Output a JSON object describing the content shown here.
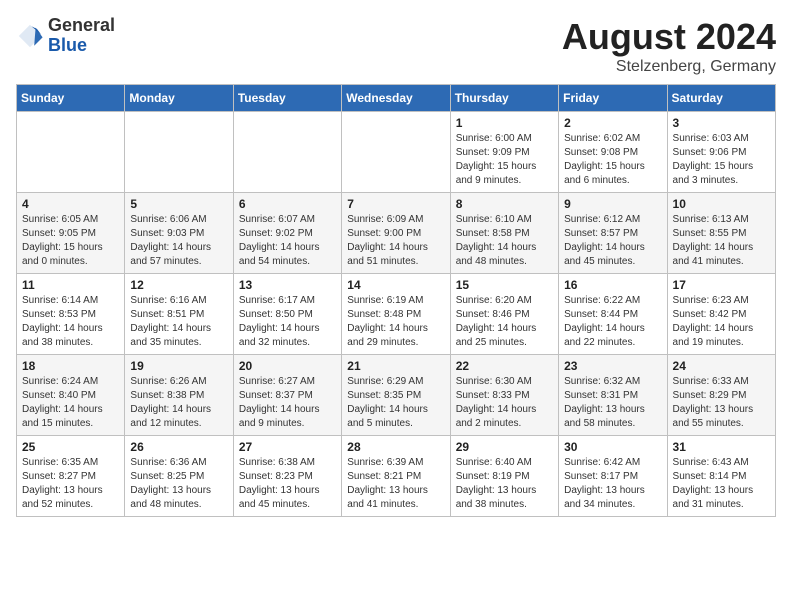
{
  "header": {
    "logo_general": "General",
    "logo_blue": "Blue",
    "month_year": "August 2024",
    "location": "Stelzenberg, Germany"
  },
  "days_of_week": [
    "Sunday",
    "Monday",
    "Tuesday",
    "Wednesday",
    "Thursday",
    "Friday",
    "Saturday"
  ],
  "weeks": [
    [
      {
        "day": "",
        "info": ""
      },
      {
        "day": "",
        "info": ""
      },
      {
        "day": "",
        "info": ""
      },
      {
        "day": "",
        "info": ""
      },
      {
        "day": "1",
        "info": "Sunrise: 6:00 AM\nSunset: 9:09 PM\nDaylight: 15 hours\nand 9 minutes."
      },
      {
        "day": "2",
        "info": "Sunrise: 6:02 AM\nSunset: 9:08 PM\nDaylight: 15 hours\nand 6 minutes."
      },
      {
        "day": "3",
        "info": "Sunrise: 6:03 AM\nSunset: 9:06 PM\nDaylight: 15 hours\nand 3 minutes."
      }
    ],
    [
      {
        "day": "4",
        "info": "Sunrise: 6:05 AM\nSunset: 9:05 PM\nDaylight: 15 hours\nand 0 minutes."
      },
      {
        "day": "5",
        "info": "Sunrise: 6:06 AM\nSunset: 9:03 PM\nDaylight: 14 hours\nand 57 minutes."
      },
      {
        "day": "6",
        "info": "Sunrise: 6:07 AM\nSunset: 9:02 PM\nDaylight: 14 hours\nand 54 minutes."
      },
      {
        "day": "7",
        "info": "Sunrise: 6:09 AM\nSunset: 9:00 PM\nDaylight: 14 hours\nand 51 minutes."
      },
      {
        "day": "8",
        "info": "Sunrise: 6:10 AM\nSunset: 8:58 PM\nDaylight: 14 hours\nand 48 minutes."
      },
      {
        "day": "9",
        "info": "Sunrise: 6:12 AM\nSunset: 8:57 PM\nDaylight: 14 hours\nand 45 minutes."
      },
      {
        "day": "10",
        "info": "Sunrise: 6:13 AM\nSunset: 8:55 PM\nDaylight: 14 hours\nand 41 minutes."
      }
    ],
    [
      {
        "day": "11",
        "info": "Sunrise: 6:14 AM\nSunset: 8:53 PM\nDaylight: 14 hours\nand 38 minutes."
      },
      {
        "day": "12",
        "info": "Sunrise: 6:16 AM\nSunset: 8:51 PM\nDaylight: 14 hours\nand 35 minutes."
      },
      {
        "day": "13",
        "info": "Sunrise: 6:17 AM\nSunset: 8:50 PM\nDaylight: 14 hours\nand 32 minutes."
      },
      {
        "day": "14",
        "info": "Sunrise: 6:19 AM\nSunset: 8:48 PM\nDaylight: 14 hours\nand 29 minutes."
      },
      {
        "day": "15",
        "info": "Sunrise: 6:20 AM\nSunset: 8:46 PM\nDaylight: 14 hours\nand 25 minutes."
      },
      {
        "day": "16",
        "info": "Sunrise: 6:22 AM\nSunset: 8:44 PM\nDaylight: 14 hours\nand 22 minutes."
      },
      {
        "day": "17",
        "info": "Sunrise: 6:23 AM\nSunset: 8:42 PM\nDaylight: 14 hours\nand 19 minutes."
      }
    ],
    [
      {
        "day": "18",
        "info": "Sunrise: 6:24 AM\nSunset: 8:40 PM\nDaylight: 14 hours\nand 15 minutes."
      },
      {
        "day": "19",
        "info": "Sunrise: 6:26 AM\nSunset: 8:38 PM\nDaylight: 14 hours\nand 12 minutes."
      },
      {
        "day": "20",
        "info": "Sunrise: 6:27 AM\nSunset: 8:37 PM\nDaylight: 14 hours\nand 9 minutes."
      },
      {
        "day": "21",
        "info": "Sunrise: 6:29 AM\nSunset: 8:35 PM\nDaylight: 14 hours\nand 5 minutes."
      },
      {
        "day": "22",
        "info": "Sunrise: 6:30 AM\nSunset: 8:33 PM\nDaylight: 14 hours\nand 2 minutes."
      },
      {
        "day": "23",
        "info": "Sunrise: 6:32 AM\nSunset: 8:31 PM\nDaylight: 13 hours\nand 58 minutes."
      },
      {
        "day": "24",
        "info": "Sunrise: 6:33 AM\nSunset: 8:29 PM\nDaylight: 13 hours\nand 55 minutes."
      }
    ],
    [
      {
        "day": "25",
        "info": "Sunrise: 6:35 AM\nSunset: 8:27 PM\nDaylight: 13 hours\nand 52 minutes."
      },
      {
        "day": "26",
        "info": "Sunrise: 6:36 AM\nSunset: 8:25 PM\nDaylight: 13 hours\nand 48 minutes."
      },
      {
        "day": "27",
        "info": "Sunrise: 6:38 AM\nSunset: 8:23 PM\nDaylight: 13 hours\nand 45 minutes."
      },
      {
        "day": "28",
        "info": "Sunrise: 6:39 AM\nSunset: 8:21 PM\nDaylight: 13 hours\nand 41 minutes."
      },
      {
        "day": "29",
        "info": "Sunrise: 6:40 AM\nSunset: 8:19 PM\nDaylight: 13 hours\nand 38 minutes."
      },
      {
        "day": "30",
        "info": "Sunrise: 6:42 AM\nSunset: 8:17 PM\nDaylight: 13 hours\nand 34 minutes."
      },
      {
        "day": "31",
        "info": "Sunrise: 6:43 AM\nSunset: 8:14 PM\nDaylight: 13 hours\nand 31 minutes."
      }
    ]
  ]
}
